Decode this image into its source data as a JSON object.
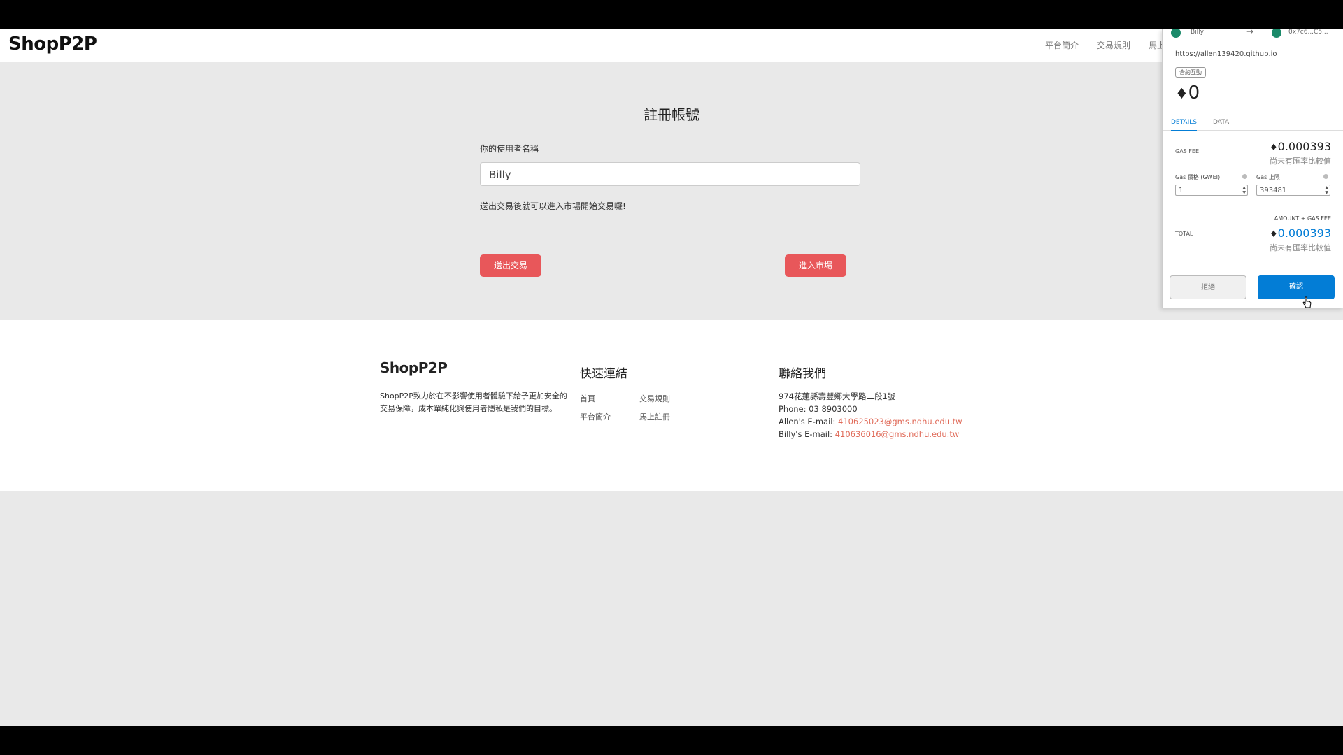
{
  "navbar": {
    "logo": "ShopP2P",
    "links": [
      "平台簡介",
      "交易規則",
      "馬上註冊"
    ]
  },
  "register": {
    "title": "註冊帳號",
    "username_label": "你的使用者名稱",
    "username_value": "Billy",
    "hint": "送出交易後就可以進入市場開始交易囉!",
    "submit_button": "送出交易",
    "enter_button": "進入市場"
  },
  "footer": {
    "logo": "ShopP2P",
    "description": "ShopP2P致力於在不影響使用者體驗下給予更加安全的交易保障，成本單純化與使用者隱私是我們的目標。",
    "quick_links_title": "快速連結",
    "quick_links": [
      "首頁",
      "交易規則",
      "平台簡介",
      "馬上註冊"
    ],
    "contact_title": "聯絡我們",
    "address": "974花蓮縣壽豐鄉大學路二段1號",
    "phone": "Phone: 03 8903000",
    "allen_label": "Allen's E-mail: ",
    "allen_email": "410625023@gms.ndhu.edu.tw",
    "billy_label": "Billy's E-mail: ",
    "billy_email": "410636016@gms.ndhu.edu.tw"
  },
  "metamask": {
    "account_from": "Billy",
    "account_to": "0x7c6...C5...",
    "origin_url": "https://allen139420.github.io",
    "tag": "合約互動",
    "amount": "0",
    "tabs": [
      "DETAILS",
      "DATA"
    ],
    "gas_fee_label": "GAS FEE",
    "gas_fee_value": "0.000393",
    "no_rate_text": "尚未有匯率比較值",
    "gas_price_label": "Gas 價格 (GWEI)",
    "gas_price_value": "1",
    "gas_limit_label": "Gas 上限",
    "gas_limit_value": "393481",
    "amount_plus_gas_label": "AMOUNT + GAS FEE",
    "total_label": "TOTAL",
    "total_value": "0.000393",
    "total_no_rate_text": "尚未有匯率比較值",
    "reject_button": "拒絕",
    "confirm_button": "確認",
    "colors": {
      "confirm": "#037dd6",
      "avatar": "#1b8a6a"
    }
  },
  "colors": {
    "accent_red": "#e8575a",
    "email_link": "#e06a58",
    "page_bg": "#e9e9e9"
  }
}
